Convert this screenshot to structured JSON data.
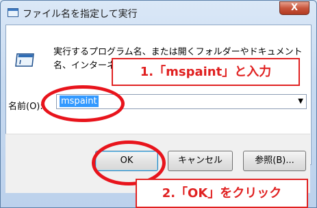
{
  "window": {
    "title": "ファイル名を指定して実行",
    "close_label": "X"
  },
  "dialog": {
    "description": "実行するプログラム名、または開くフォルダーやドキュメント名、インターネットリソース名を入力してください。",
    "name_label": "名前(O):",
    "name_value": "mspaint"
  },
  "buttons": {
    "ok": "OK",
    "cancel": "キャンセル",
    "browse": "参照(B)..."
  },
  "annotations": {
    "step1": "1.「mspaint」と入力",
    "step2": "2.「OK」をクリック"
  },
  "colors": {
    "annotation_red": "#e8141c",
    "selection_blue": "#3399ff"
  }
}
